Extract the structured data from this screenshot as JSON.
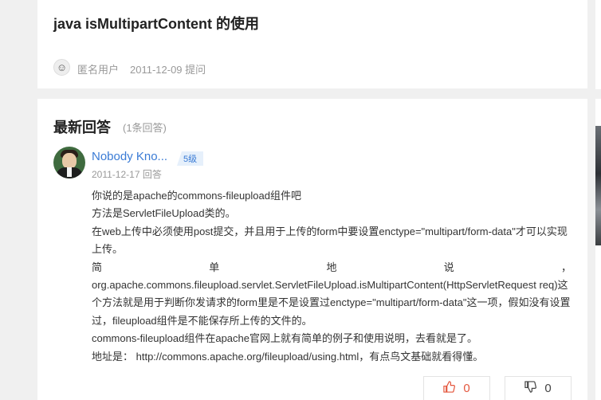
{
  "question": {
    "title": "java isMultipartContent 的使用",
    "user": "匿名用户",
    "date_action": "2011-12-09 提问"
  },
  "answers": {
    "heading": "最新回答",
    "count": "(1条回答)",
    "items": [
      {
        "username": "Nobody Kno...",
        "level": "5级",
        "date_action": "2011-12-17 回答",
        "body": {
          "line1": "你说的是apache的commons-fileupload组件吧",
          "line2": "方法是ServletFileUpload类的。",
          "line3": "在web上传中必须使用post提交，并且用于上传的form中要设置enctype=\"multipart/form-data\"才可以实现上传。",
          "justified": [
            "简",
            "单",
            "地",
            "说",
            "，"
          ],
          "line5": "org.apache.commons.fileupload.servlet.ServletFileUpload.isMultipartContent(HttpServletRequest req)这个方法就是用于判断你发请求的form里是不是设置过enctype=\"multipart/form-data\"这一项，假如没有设置过，fileupload组件是不能保存所上传的文件的。",
          "line6": "commons-fileupload组件在apache官网上就有简单的例子和使用说明，去看就是了。",
          "line7": "地址是： http://commons.apache.org/fileupload/using.html，有点鸟文基础就看得懂。"
        },
        "likes": "0",
        "dislikes": "0"
      }
    ]
  },
  "icons": {
    "like": "thumbs-up-icon",
    "dislike": "thumbs-down-icon"
  }
}
